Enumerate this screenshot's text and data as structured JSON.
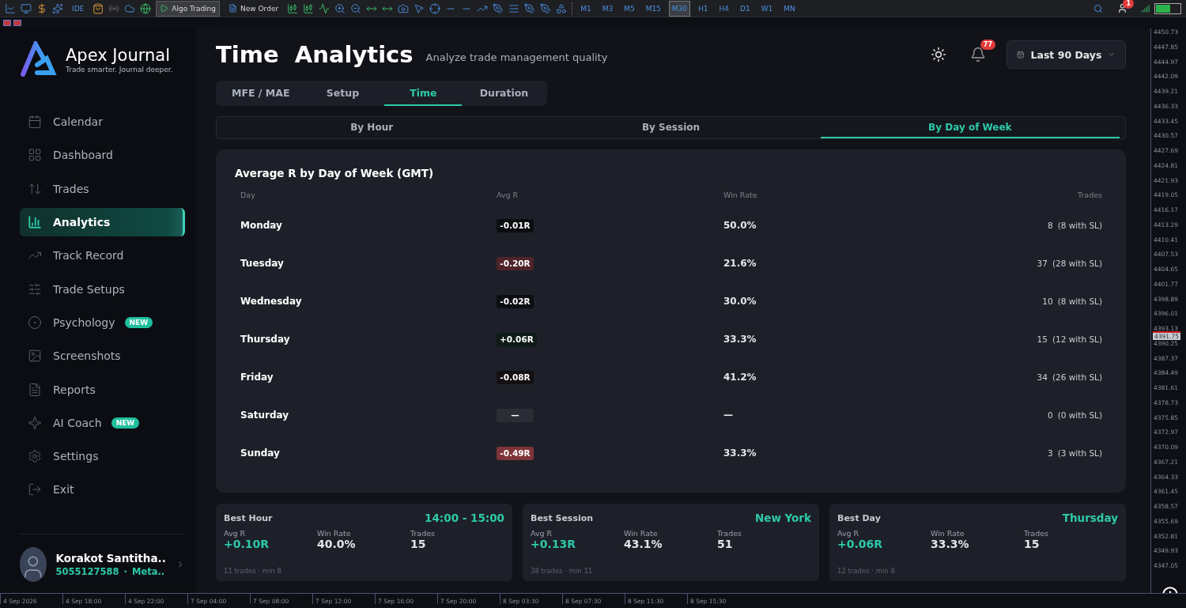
{
  "toolbar": {
    "ide": "IDE",
    "algo_trading": "Algo Trading",
    "new_order": "New Order",
    "timeframes": [
      {
        "label": "M1",
        "selected": false
      },
      {
        "label": "M3",
        "selected": false
      },
      {
        "label": "M5",
        "selected": false
      },
      {
        "label": "M15",
        "selected": false
      },
      {
        "label": "M30",
        "selected": true
      },
      {
        "label": "H1",
        "selected": false
      },
      {
        "label": "H4",
        "selected": false
      },
      {
        "label": "D1",
        "selected": false
      },
      {
        "label": "W1",
        "selected": false
      },
      {
        "label": "MN",
        "selected": false
      }
    ],
    "notification_count": "1"
  },
  "brand": {
    "name": "Apex Journal",
    "tagline": "Trade smarter. Journal deeper."
  },
  "sidebar": {
    "items": [
      {
        "label": "Calendar",
        "selected": false
      },
      {
        "label": "Dashboard",
        "selected": false
      },
      {
        "label": "Trades",
        "selected": false
      },
      {
        "label": "Analytics",
        "selected": true
      },
      {
        "label": "Track Record",
        "selected": false
      },
      {
        "label": "Trade Setups",
        "selected": false
      },
      {
        "label": "Psychology",
        "selected": false,
        "badge": "NEW"
      },
      {
        "label": "Screenshots",
        "selected": false
      },
      {
        "label": "Reports",
        "selected": false
      },
      {
        "label": "AI Coach",
        "selected": false,
        "badge": "NEW"
      },
      {
        "label": "Settings",
        "selected": false
      },
      {
        "label": "Exit",
        "selected": false
      }
    ],
    "user": {
      "name": "Korakot Santitha..",
      "account": "5055127588",
      "separator": "·",
      "platform": "Meta.."
    }
  },
  "header": {
    "title": "Time  Analytics",
    "subtitle": "Analyze trade management quality",
    "notifications": "77",
    "range": "Last 90 Days"
  },
  "tabs": [
    {
      "label": "MFE / MAE",
      "selected": false
    },
    {
      "label": "Setup",
      "selected": false
    },
    {
      "label": "Time",
      "selected": true
    },
    {
      "label": "Duration",
      "selected": false
    }
  ],
  "subtabs": [
    {
      "label": "By Hour",
      "selected": false
    },
    {
      "label": "By Session",
      "selected": false
    },
    {
      "label": "By Day of Week",
      "selected": true
    }
  ],
  "table": {
    "title": "Average R by Day of Week (GMT)",
    "columns": [
      "Day",
      "Avg R",
      "Win Rate",
      "Trades"
    ],
    "rows": [
      {
        "day": "Monday",
        "avg_r": "-0.01R",
        "color": "#0b0d11",
        "win_rate": "50.0%",
        "trades": "8",
        "with_sl": "(8 with SL)"
      },
      {
        "day": "Tuesday",
        "avg_r": "-0.20R",
        "color": "#4e2429",
        "win_rate": "21.6%",
        "trades": "37",
        "with_sl": "(28 with SL)"
      },
      {
        "day": "Wednesday",
        "avg_r": "-0.02R",
        "color": "#0c0e12",
        "win_rate": "30.0%",
        "trades": "10",
        "with_sl": "(8 with SL)"
      },
      {
        "day": "Thursday",
        "avg_r": "+0.06R",
        "color": "#0f1a17",
        "win_rate": "33.3%",
        "trades": "15",
        "with_sl": "(12 with SL)"
      },
      {
        "day": "Friday",
        "avg_r": "-0.08R",
        "color": "#140f12",
        "win_rate": "41.2%",
        "trades": "34",
        "with_sl": "(26 with SL)"
      },
      {
        "day": "Saturday",
        "avg_r": "—",
        "color": "#2a2d35",
        "win_rate": "—",
        "trades": "0",
        "with_sl": "(0 with SL)"
      },
      {
        "day": "Sunday",
        "avg_r": "-0.49R",
        "color": "#7e3438",
        "win_rate": "33.3%",
        "trades": "3",
        "with_sl": "(3 with SL)"
      }
    ]
  },
  "best": [
    {
      "title": "Best Hour",
      "value": "14:00 - 15:00",
      "stats": [
        {
          "label": "Avg R",
          "value": "+0.10R"
        },
        {
          "label": "Win Rate",
          "value": "40.0%"
        },
        {
          "label": "Trades",
          "value": "15"
        }
      ],
      "footer": "11 trades · min 8"
    },
    {
      "title": "Best Session",
      "value": "New York",
      "stats": [
        {
          "label": "Avg R",
          "value": "+0.13R"
        },
        {
          "label": "Win Rate",
          "value": "43.1%"
        },
        {
          "label": "Trades",
          "value": "51"
        }
      ],
      "footer": "38 trades · min 11"
    },
    {
      "title": "Best Day",
      "value": "Thursday",
      "stats": [
        {
          "label": "Avg R",
          "value": "+0.06R"
        },
        {
          "label": "Win Rate",
          "value": "33.3%"
        },
        {
          "label": "Trades",
          "value": "15"
        }
      ],
      "footer": "12 trades · min 8"
    }
  ],
  "price_axis": {
    "labels": [
      "4450.73",
      "4447.85",
      "4444.97",
      "4442.09",
      "4439.21",
      "4436.33",
      "4433.45",
      "4430.57",
      "4427.69",
      "4424.81",
      "4421.93",
      "4419.05",
      "4416.17",
      "4413.29",
      "4410.41",
      "4407.53",
      "4404.65",
      "4401.77",
      "4398.89",
      "4396.01",
      "4393.13",
      "4390.25",
      "4387.37",
      "4384.49",
      "4381.61",
      "4378.73",
      "4375.85",
      "4372.97",
      "4370.09",
      "4367.21",
      "4364.33",
      "4361.45",
      "4358.57",
      "4355.69",
      "4352.81",
      "4349.93",
      "4347.05"
    ],
    "current": "4391.75"
  },
  "time_axis": [
    "4 Sep 2026",
    "4 Sep 18:00",
    "4 Sep 22:00",
    "7 Sep 04:00",
    "7 Sep 08:00",
    "7 Sep 12:00",
    "7 Sep 16:00",
    "7 Sep 20:00",
    "8 Sep 03:30",
    "8 Sep 07:30",
    "8 Sep 11:30",
    "8 Sep 15:30"
  ]
}
